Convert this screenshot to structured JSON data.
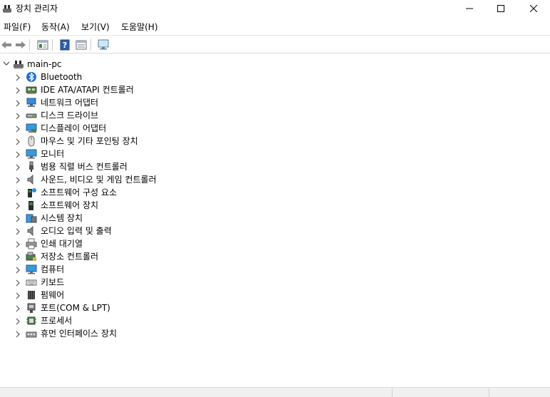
{
  "window": {
    "title": "장치 관리자",
    "icon": "device-manager-icon"
  },
  "menu": {
    "items": [
      "파일(F)",
      "동작(A)",
      "보기(V)",
      "도움말(H)"
    ]
  },
  "toolbar": {
    "buttons": [
      "back-icon",
      "forward-icon",
      "properties-icon",
      "help-icon",
      "view-icon",
      "monitor-scan-icon"
    ]
  },
  "tree": {
    "root": "main-pc",
    "categories": [
      {
        "label": "Bluetooth",
        "icon": "bluetooth-icon"
      },
      {
        "label": "IDE ATA/ATAPI 컨트롤러",
        "icon": "ide-controller-icon"
      },
      {
        "label": "네트워크 어댑터",
        "icon": "network-adapter-icon"
      },
      {
        "label": "디스크 드라이브",
        "icon": "disk-drive-icon"
      },
      {
        "label": "디스플레이 어댑터",
        "icon": "display-adapter-icon"
      },
      {
        "label": "마우스 및 기타 포인팅 장치",
        "icon": "mouse-icon"
      },
      {
        "label": "모니터",
        "icon": "monitor-icon"
      },
      {
        "label": "범용 직렬 버스 컨트롤러",
        "icon": "usb-icon"
      },
      {
        "label": "사운드, 비디오 및 게임 컨트롤러",
        "icon": "speaker-icon"
      },
      {
        "label": "소프트웨어 구성 요소",
        "icon": "software-component-icon"
      },
      {
        "label": "소프트웨어 장치",
        "icon": "software-device-icon"
      },
      {
        "label": "시스템 장치",
        "icon": "system-device-icon"
      },
      {
        "label": "오디오 입력 및 출력",
        "icon": "audio-io-icon"
      },
      {
        "label": "인쇄 대기열",
        "icon": "printer-icon"
      },
      {
        "label": "저장소 컨트롤러",
        "icon": "storage-controller-icon"
      },
      {
        "label": "컴퓨터",
        "icon": "computer-icon"
      },
      {
        "label": "키보드",
        "icon": "keyboard-icon"
      },
      {
        "label": "펌웨어",
        "icon": "firmware-icon"
      },
      {
        "label": "포트(COM & LPT)",
        "icon": "port-icon"
      },
      {
        "label": "프로세서",
        "icon": "processor-icon"
      },
      {
        "label": "휴먼 인터페이스 장치",
        "icon": "hid-icon"
      }
    ]
  }
}
